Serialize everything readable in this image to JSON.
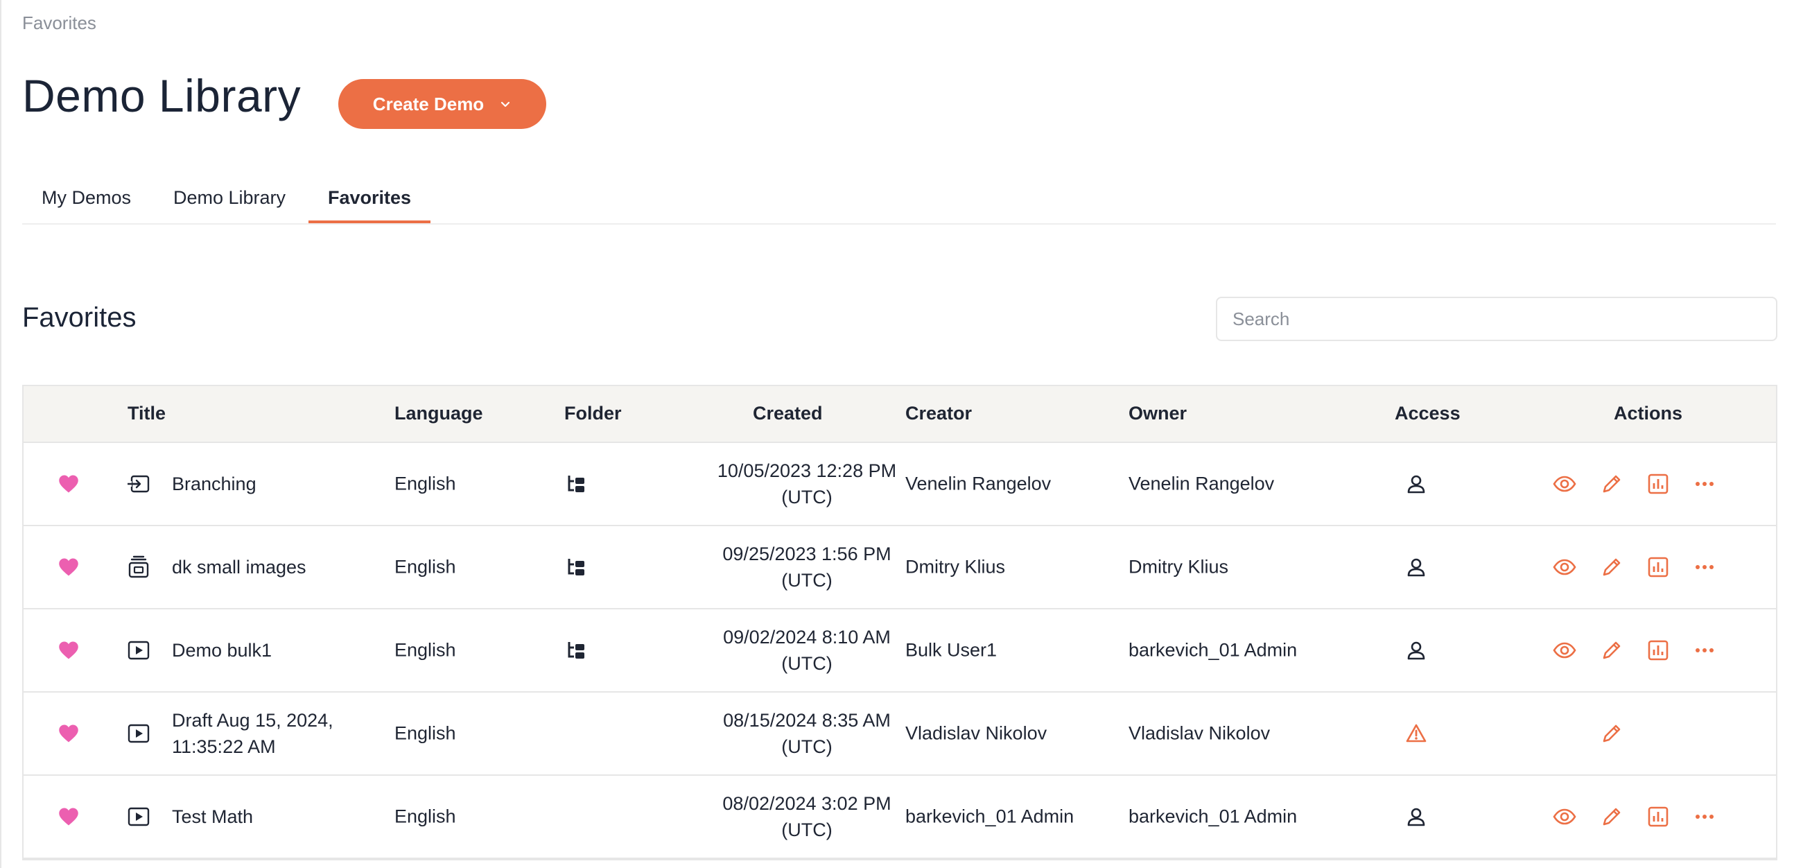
{
  "breadcrumb": "Favorites",
  "page_title": "Demo Library",
  "create_button": "Create Demo",
  "tabs": [
    {
      "label": "My Demos",
      "active": false
    },
    {
      "label": "Demo Library",
      "active": false
    },
    {
      "label": "Favorites",
      "active": true
    }
  ],
  "section_title": "Favorites",
  "search": {
    "placeholder": "Search",
    "value": ""
  },
  "colors": {
    "accent": "#ec6f45",
    "heart": "#ec5fb0",
    "header_bg": "#f5f4f1"
  },
  "table": {
    "headers": {
      "title": "Title",
      "language": "Language",
      "folder": "Folder",
      "created": "Created",
      "creator": "Creator",
      "owner": "Owner",
      "access": "Access",
      "actions": "Actions"
    },
    "rows": [
      {
        "type_icon": "branching-icon",
        "title": "Branching",
        "language": "English",
        "folder_icon": "folder-tree-icon",
        "created_date": "10/05/2023 12:28 PM",
        "created_tz": "(UTC)",
        "creator": "Venelin Rangelov",
        "owner": "Venelin Rangelov",
        "access_icon": "user-icon"
      },
      {
        "type_icon": "slides-icon",
        "title": "dk small images",
        "language": "English",
        "folder_icon": "folder-tree-icon",
        "created_date": "09/25/2023 1:56 PM",
        "created_tz": "(UTC)",
        "creator": "Dmitry Klius",
        "owner": "Dmitry Klius",
        "access_icon": "user-icon"
      },
      {
        "type_icon": "video-icon",
        "title": "Demo bulk1",
        "language": "English",
        "folder_icon": "folder-tree-icon",
        "created_date": "09/02/2024 8:10 AM",
        "created_tz": "(UTC)",
        "creator": "Bulk User1",
        "owner": "barkevich_01 Admin",
        "access_icon": "user-icon"
      },
      {
        "type_icon": "video-icon",
        "title_line1": "Draft Aug 15, 2024,",
        "title_line2": "11:35:22 AM",
        "language": "English",
        "folder_icon": "",
        "created_date": "08/15/2024 8:35 AM",
        "created_tz": "(UTC)",
        "creator": "Vladislav Nikolov",
        "owner": "Vladislav Nikolov",
        "access_icon": "warning-icon"
      },
      {
        "type_icon": "video-icon",
        "title": "Test Math",
        "language": "English",
        "folder_icon": "",
        "created_date": "08/02/2024 3:02 PM",
        "created_tz": "(UTC)",
        "creator": "barkevich_01 Admin",
        "owner": "barkevich_01 Admin",
        "access_icon": "user-icon"
      }
    ]
  }
}
